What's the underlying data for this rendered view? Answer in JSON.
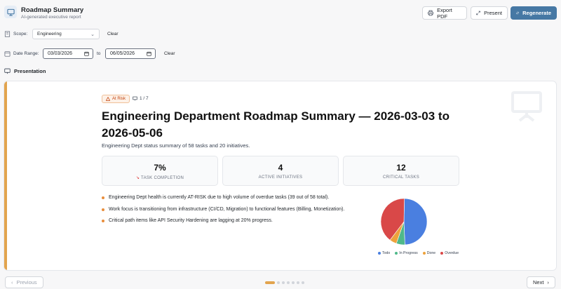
{
  "app": {
    "title": "Roadmap Summary",
    "subtitle": "AI-generated executive report"
  },
  "toolbar": {
    "export_label": "Export PDF",
    "present_label": "Present",
    "regenerate_label": "Regenerate"
  },
  "filters": {
    "scope_label": "Scope:",
    "scope_value": "Engineering",
    "scope_clear": "Clear",
    "date_label": "Date Range:",
    "date_from": "03/03/2026",
    "date_to_label": "to",
    "date_to": "06/05/2026",
    "date_clear": "Clear"
  },
  "section": {
    "label": "Presentation"
  },
  "slide": {
    "badge": "At Risk",
    "counter": "1 / 7",
    "title": "Engineering Department Roadmap Summary — 2026-03-03 to 2026-05-06",
    "summary": "Engineering Dept status summary of 58 tasks and 20 initiatives.",
    "stats": [
      {
        "value": "7%",
        "label": "TASK COMPLETION",
        "trend": "↘"
      },
      {
        "value": "4",
        "label": "ACTIVE INITIATIVES"
      },
      {
        "value": "12",
        "label": "CRITICAL TASKS"
      }
    ],
    "bullets": [
      "Engineering Dept health is currently AT-RISK due to high volume of overdue tasks (39 out of 58 total).",
      "Work focus is transitioning from infrastructure (CI/CD, Migration) to functional features (Billing, Monetization).",
      "Critical path items like API Security Hardening are lagging at 20% progress."
    ]
  },
  "chart_data": {
    "type": "pie",
    "categories": [
      "Todo",
      "In Progress",
      "Done",
      "Overdue"
    ],
    "values": [
      49,
      6,
      5,
      40
    ],
    "colors": [
      "#4a7fe0",
      "#4fb98a",
      "#eda23c",
      "#d94848"
    ]
  },
  "footer": {
    "prev_label": "Previous",
    "next_label": "Next",
    "page_count": 7,
    "current_page": 1
  }
}
